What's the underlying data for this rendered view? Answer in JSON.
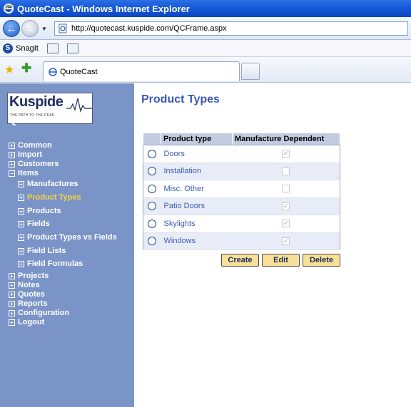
{
  "browser": {
    "window_title": "QuoteCast - Windows Internet Explorer",
    "url": "http://quotecast.kuspide.com/QCFrame.aspx",
    "toolbar_snagit_label": "SnagIt",
    "tab_label": "QuoteCast"
  },
  "logo": {
    "word": "Kuspide",
    "tagline": "THE PATH TO THE PEAK",
    "app_name": "Quote Cast"
  },
  "sidebar": {
    "items": [
      {
        "label": "Common",
        "expander": "+"
      },
      {
        "label": "Import",
        "expander": "+"
      },
      {
        "label": "Customers",
        "expander": "+"
      },
      {
        "label": "Items",
        "expander": "−"
      },
      {
        "label": "Manufactures",
        "expander": "+"
      },
      {
        "label": "Product Types",
        "expander": "+"
      },
      {
        "label": "Products",
        "expander": "+"
      },
      {
        "label": "Fields",
        "expander": "+"
      },
      {
        "label": "Product Types vs Fields",
        "expander": "+"
      },
      {
        "label": "Field Lists",
        "expander": "+"
      },
      {
        "label": "Field Formulas",
        "expander": "+"
      },
      {
        "label": "Projects",
        "expander": "+"
      },
      {
        "label": "Notes",
        "expander": "+"
      },
      {
        "label": "Quotes",
        "expander": "+"
      },
      {
        "label": "Reports",
        "expander": "+"
      },
      {
        "label": "Configuration",
        "expander": "+"
      },
      {
        "label": "Logout",
        "expander": "+"
      }
    ],
    "active_item": "Product Types"
  },
  "main": {
    "title": "Product Types",
    "table": {
      "headers": [
        "",
        "Product type",
        "Manufacture Dependent"
      ],
      "rows": [
        {
          "name": "Doors",
          "manufacture_dependent": true
        },
        {
          "name": "Installation",
          "manufacture_dependent": false
        },
        {
          "name": "Misc. Other",
          "manufacture_dependent": false
        },
        {
          "name": "Patio Doors",
          "manufacture_dependent": true
        },
        {
          "name": "Skylights",
          "manufacture_dependent": true
        },
        {
          "name": "Windows",
          "manufacture_dependent": true
        }
      ]
    },
    "buttons": {
      "create": "Create",
      "edit": "Edit",
      "delete": "Delete"
    }
  },
  "colors": {
    "sidebar_bg": "#7b94c8",
    "active_nav": "#f5d33a",
    "title_blue": "#3b5bb2",
    "button_bg": "#f8e098"
  }
}
